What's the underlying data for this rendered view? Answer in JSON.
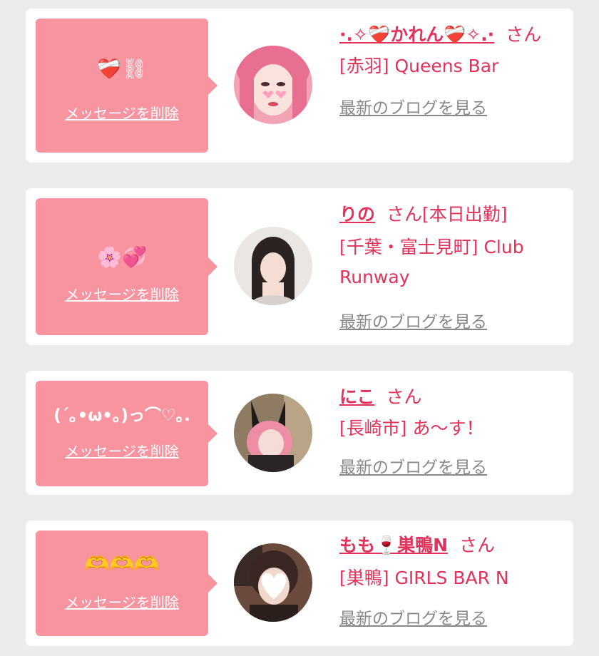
{
  "accent_color": "#e0325a",
  "bubble_color": "#f7949f",
  "delete_label": "メッセージを削除",
  "blog_label": "最新のブログを見る",
  "san_label": "さん",
  "messages": [
    {
      "message": "❤️‍🩹⛓",
      "name": "·.✧❤️‍🩹かれん❤️‍🩹✧.·",
      "after_san": "",
      "shop": "[赤羽] Queens Bar",
      "avatar_icon": "pink-hair-avatar-icon"
    },
    {
      "message": "🌸💞",
      "name": "りの",
      "after_san": "[本日出勤]",
      "shop": "[千葉・富士見町] Club Runway",
      "avatar_icon": "dark-hair-avatar-icon"
    },
    {
      "message": "(´｡•ω•｡)っ⌒♡｡.",
      "name": "にこ",
      "after_san": "",
      "shop": "[長崎市] あ〜す！",
      "avatar_icon": "bunny-ears-avatar-icon"
    },
    {
      "message": "🫶🫶🫶",
      "name": "もも🍷巣鴨N",
      "after_san": "",
      "shop": "[巣鴨] GIRLS BAR N",
      "avatar_icon": "heart-mask-avatar-icon"
    }
  ]
}
